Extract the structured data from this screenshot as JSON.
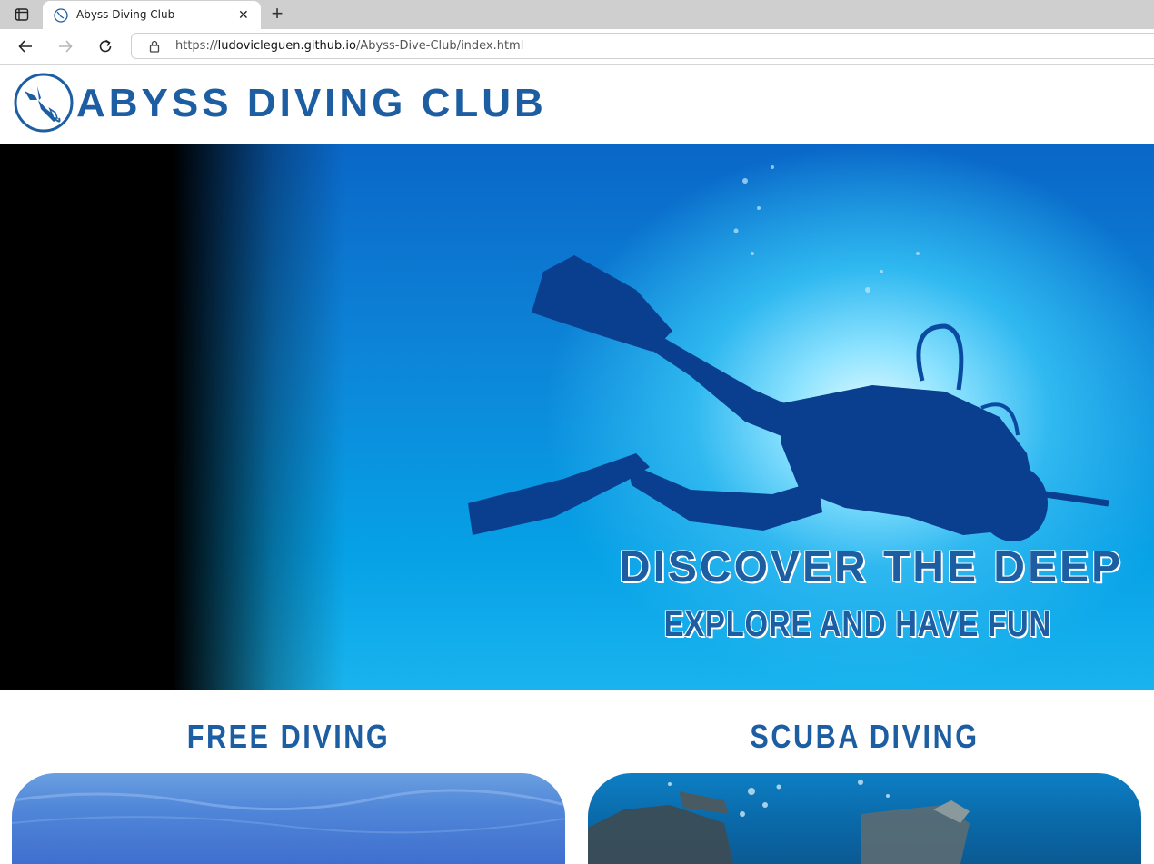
{
  "browser": {
    "tab_title": "Abyss Diving Club",
    "url_prefix": "https://",
    "url_host": "ludovicleguen.github.io",
    "url_path": "/Abyss-Dive-Club/index.html"
  },
  "header": {
    "site_title": "ABYSS DIVING CLUB"
  },
  "hero": {
    "title": "DISCOVER THE DEEP",
    "subtitle": "EXPLORE AND HAVE FUN"
  },
  "sections": [
    {
      "title": "FREE DIVING"
    },
    {
      "title": "SCUBA DIVING"
    }
  ],
  "colors": {
    "brand": "#1d5ea3"
  }
}
